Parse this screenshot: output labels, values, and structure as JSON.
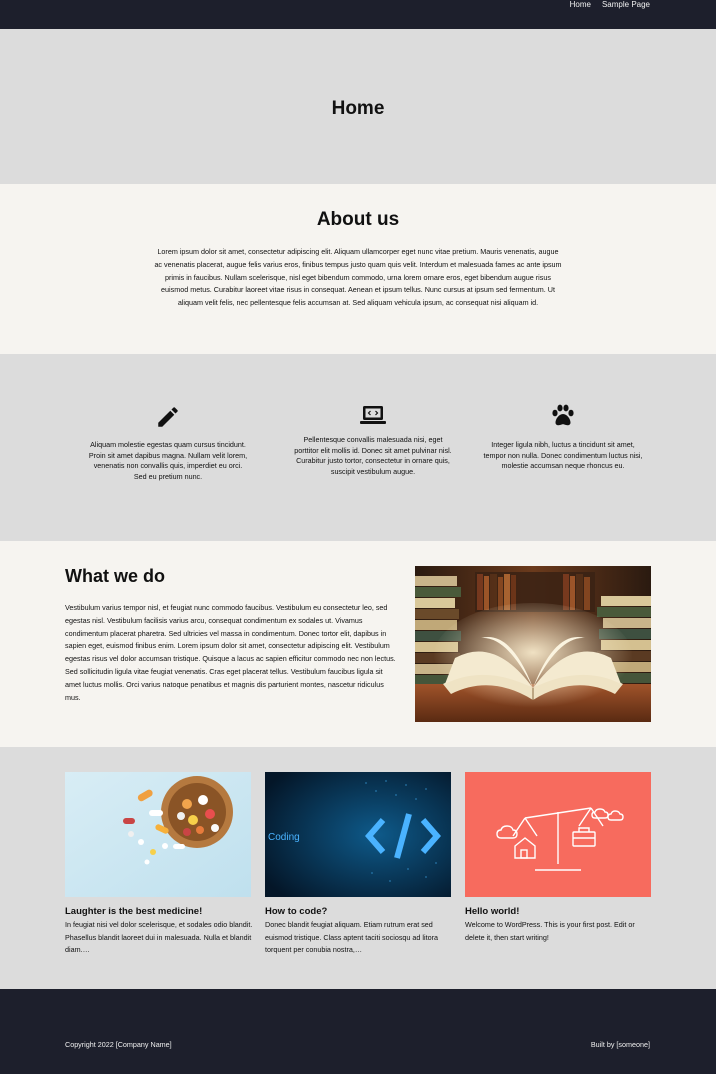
{
  "nav": {
    "home": "Home",
    "sample_page": "Sample Page"
  },
  "hero": {
    "title": "Home"
  },
  "about": {
    "title": "About us",
    "text": "Lorem ipsum dolor sit amet, consectetur adipiscing elit. Aliquam ullamcorper eget nunc vitae pretium. Mauris venenatis, augue ac venenatis placerat, augue felis varius eros, finibus tempus justo quam quis velit. Interdum et malesuada fames ac ante ipsum primis in faucibus. Nullam scelerisque, nisl eget bibendum commodo, urna lorem ornare eros, eget bibendum augue risus euismod metus. Curabitur laoreet vitae risus in consequat. Aenean et ipsum tellus. Nunc cursus at ipsum sed fermentum. Ut aliquam velit felis, nec pellentesque felis accumsan at. Sed aliquam vehicula ipsum, ac consequat nisi aliquam id."
  },
  "features": [
    {
      "icon": "pencil-icon",
      "text": "Aliquam molestie egestas quam cursus tincidunt. Proin sit amet dapibus magna. Nullam velit lorem, venenatis non convallis quis, imperdiet eu orci. Sed eu pretium nunc."
    },
    {
      "icon": "laptop-code-icon",
      "text": "Pellentesque convallis malesuada nisi, eget porttitor elit mollis id. Donec sit amet pulvinar nisl. Curabitur justo tortor, consectetur in ornare quis, suscipit vestibulum augue."
    },
    {
      "icon": "paw-icon",
      "text": "Integer ligula nibh, luctus a tincidunt sit amet, tempor non nulla. Donec condimentum luctus nisi, molestie accumsan neque rhoncus eu."
    }
  ],
  "whatwedo": {
    "title": "What we do",
    "text": "Vestibulum varius tempor nisl, et feugiat nunc commodo faucibus. Vestibulum eu consectetur leo, sed egestas nisl. Vestibulum facilisis varius arcu, consequat condimentum ex sodales ut. Vivamus condimentum placerat pharetra. Sed ultricies vel massa in condimentum. Donec tortor elit, dapibus in sapien eget, euismod finibus enim. Lorem ipsum dolor sit amet, consectetur adipiscing elit. Vestibulum egestas risus vel dolor accumsan tristique. Quisque a lacus ac sapien efficitur commodo nec non lectus. Sed sollicitudin ligula vitae feugiat venenatis. Cras eget placerat tellus. Vestibulum faucibus ligula sit amet luctus mollis. Orci varius natoque penatibus et magnis dis parturient montes, nascetur ridiculus mus."
  },
  "posts": [
    {
      "title": "Laughter is the best medicine!",
      "excerpt": "In feugiat nisi vel dolor scelerisque, et sodales odio blandit. Phasellus blandit laoreet dui in malesuada. Nulla et blandit diam.…"
    },
    {
      "title": "How to code?",
      "excerpt": "Donec blandit feugiat aliquam. Etiam rutrum erat sed euismod tristique. Class aptent taciti sociosqu ad litora torquent per conubia nostra,…",
      "image_text": "Coding"
    },
    {
      "title": "Hello world!",
      "excerpt": "Welcome to WordPress. This is your first post. Edit or delete it, then start writing!"
    }
  ],
  "footer": {
    "copyright": "Copyright 2022 [Company Name]",
    "built_by": "Built by [someone]"
  },
  "colors": {
    "dark": "#1d1f2c",
    "gray_band": "#dcdcdc",
    "cream_band": "#f6f4f0",
    "coral": "#f76b5e",
    "code_blue": "#4ab3ff"
  }
}
